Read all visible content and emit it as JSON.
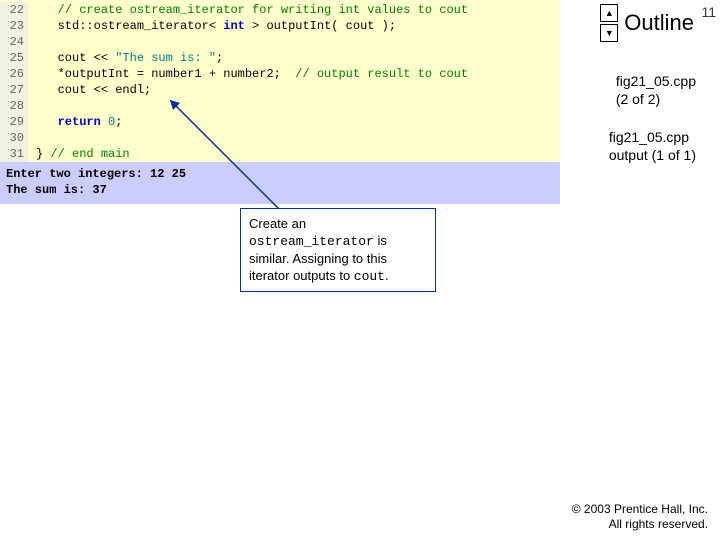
{
  "pageNumber": "11",
  "outlineLabel": "Outline",
  "code": {
    "lines": [
      {
        "n": "22",
        "pre": "   ",
        "parts": [
          {
            "t": "// create ostream_iterator for writing int values to cout",
            "cls": "kw-green"
          }
        ]
      },
      {
        "n": "23",
        "pre": "   ",
        "parts": [
          {
            "t": "std::ostream_iterator< "
          },
          {
            "t": "int",
            "cls": "kw-blue"
          },
          {
            "t": " > outputInt( cout );"
          }
        ]
      },
      {
        "n": "24",
        "pre": "",
        "parts": []
      },
      {
        "n": "25",
        "pre": "   ",
        "parts": [
          {
            "t": "cout << "
          },
          {
            "t": "\"The sum is: \"",
            "cls": "kw-teal"
          },
          {
            "t": ";"
          }
        ]
      },
      {
        "n": "26",
        "pre": "   ",
        "parts": [
          {
            "t": "*outputInt = number1 + number2;  "
          },
          {
            "t": "// output result to cout",
            "cls": "kw-green"
          }
        ]
      },
      {
        "n": "27",
        "pre": "   ",
        "parts": [
          {
            "t": "cout << endl;"
          }
        ]
      },
      {
        "n": "28",
        "pre": "",
        "parts": []
      },
      {
        "n": "29",
        "pre": "   ",
        "parts": [
          {
            "t": "return",
            "cls": "kw-blue"
          },
          {
            "t": " "
          },
          {
            "t": "0",
            "cls": "kw-teal"
          },
          {
            "t": ";"
          }
        ]
      },
      {
        "n": "30",
        "pre": "",
        "parts": []
      },
      {
        "n": "31",
        "pre": "",
        "parts": [
          {
            "t": "} "
          },
          {
            "t": "// end main",
            "cls": "kw-green"
          }
        ]
      }
    ]
  },
  "output": {
    "line1": "Enter two integers: 12 25",
    "line2": "The sum is: 37"
  },
  "sidebar": {
    "note1a": "fig21_05.cpp",
    "note1b": "(2 of 2)",
    "note2a": "fig21_05.cpp",
    "note2b": "output (1 of 1)"
  },
  "callout": {
    "t1": "Create an ",
    "m1": "ostream_iterator",
    "t2": " is similar. Assigning to this iterator outputs to ",
    "m2": "cout",
    "t3": "."
  },
  "copyright": {
    "l1": "© 2003 Prentice Hall, Inc.",
    "l2": "All rights reserved."
  }
}
